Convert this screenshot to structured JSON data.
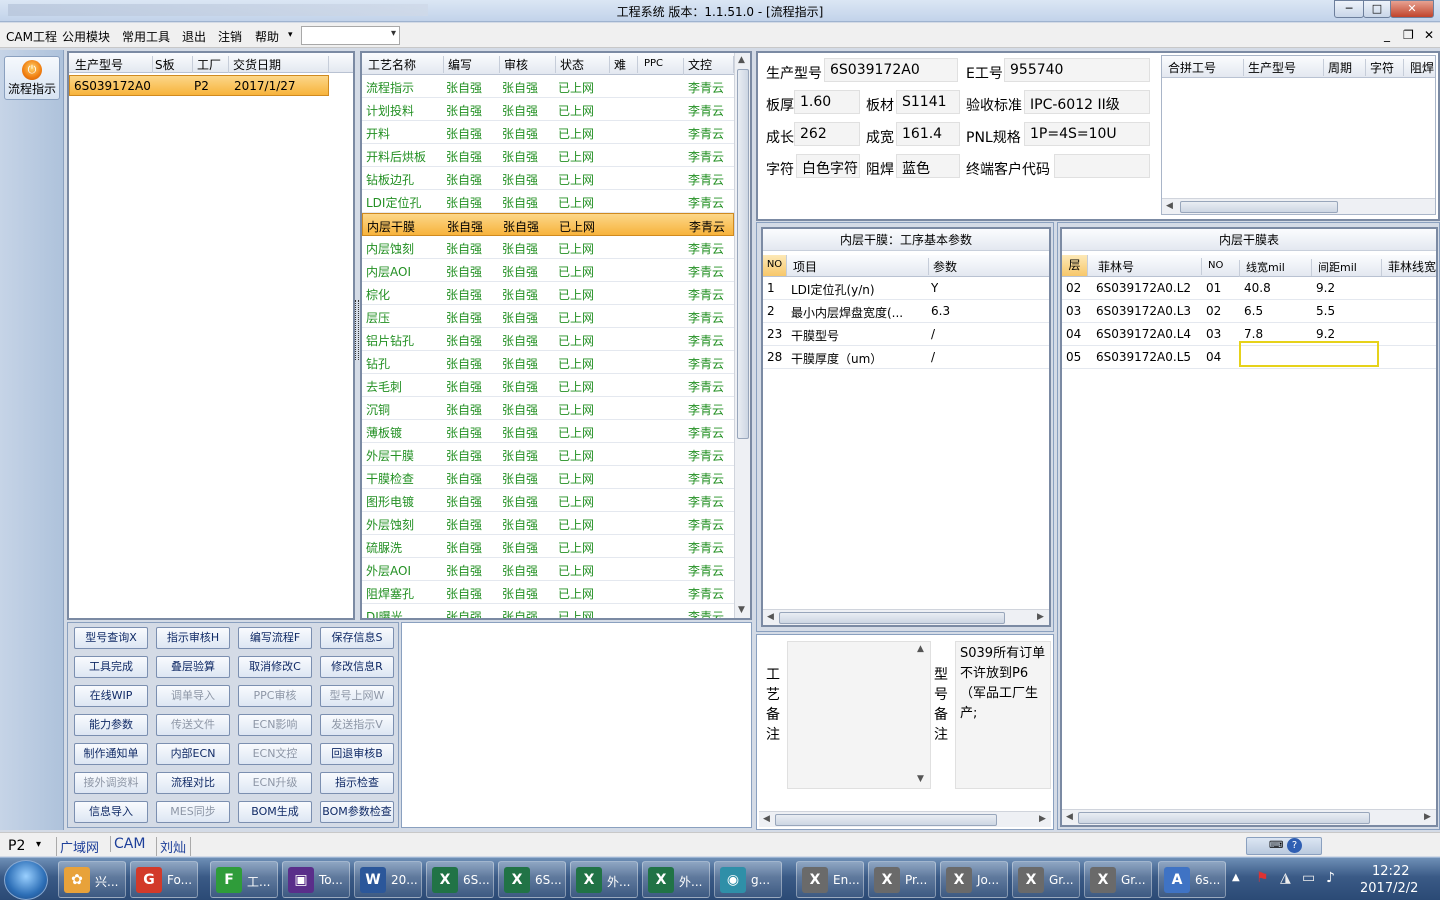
{
  "window": {
    "title": "工程系统   版本：1.1.51.0 - [流程指示]",
    "minimize": "─",
    "maximize": "□",
    "close": "✕"
  },
  "menu": {
    "items": [
      "CAM工程",
      "公用模块",
      "常用工具",
      "退出",
      "注销",
      "帮助"
    ],
    "help_arrow": "▾",
    "mdi_min": "_",
    "mdi_restore": "❐",
    "mdi_close": "✕"
  },
  "sidebar": {
    "flow_label": "流程指示"
  },
  "orders": {
    "headers": [
      "生产型号",
      "S板",
      "工厂",
      "交货日期"
    ],
    "rows": [
      [
        "6S039172A0",
        "",
        "P2",
        "2017/1/27"
      ]
    ]
  },
  "process": {
    "headers": [
      "工艺名称",
      "编写",
      "审核",
      "状态",
      "难",
      "PPC",
      "文控"
    ],
    "rows": [
      [
        "流程指示",
        "张自强",
        "张自强",
        "已上网",
        "",
        "",
        "李青云"
      ],
      [
        "计划投料",
        "张自强",
        "张自强",
        "已上网",
        "",
        "",
        "李青云"
      ],
      [
        "开料",
        "张自强",
        "张自强",
        "已上网",
        "",
        "",
        "李青云"
      ],
      [
        "开料后烘板",
        "张自强",
        "张自强",
        "已上网",
        "",
        "",
        "李青云"
      ],
      [
        "钻板边孔",
        "张自强",
        "张自强",
        "已上网",
        "",
        "",
        "李青云"
      ],
      [
        "LDI定位孔",
        "张自强",
        "张自强",
        "已上网",
        "",
        "",
        "李青云"
      ],
      [
        "内层干膜",
        "张自强",
        "张自强",
        "已上网",
        "",
        "",
        "李青云"
      ],
      [
        "内层蚀刻",
        "张自强",
        "张自强",
        "已上网",
        "",
        "",
        "李青云"
      ],
      [
        "内层AOI",
        "张自强",
        "张自强",
        "已上网",
        "",
        "",
        "李青云"
      ],
      [
        "棕化",
        "张自强",
        "张自强",
        "已上网",
        "",
        "",
        "李青云"
      ],
      [
        "层压",
        "张自强",
        "张自强",
        "已上网",
        "",
        "",
        "李青云"
      ],
      [
        "铝片钻孔",
        "张自强",
        "张自强",
        "已上网",
        "",
        "",
        "李青云"
      ],
      [
        "钻孔",
        "张自强",
        "张自强",
        "已上网",
        "",
        "",
        "李青云"
      ],
      [
        "去毛刺",
        "张自强",
        "张自强",
        "已上网",
        "",
        "",
        "李青云"
      ],
      [
        "沉铜",
        "张自强",
        "张自强",
        "已上网",
        "",
        "",
        "李青云"
      ],
      [
        "薄板镀",
        "张自强",
        "张自强",
        "已上网",
        "",
        "",
        "李青云"
      ],
      [
        "外层干膜",
        "张自强",
        "张自强",
        "已上网",
        "",
        "",
        "李青云"
      ],
      [
        "干膜检查",
        "张自强",
        "张自强",
        "已上网",
        "",
        "",
        "李青云"
      ],
      [
        "图形电镀",
        "张自强",
        "张自强",
        "已上网",
        "",
        "",
        "李青云"
      ],
      [
        "外层蚀刻",
        "张自强",
        "张自强",
        "已上网",
        "",
        "",
        "李青云"
      ],
      [
        "硫脲洗",
        "张自强",
        "张自强",
        "已上网",
        "",
        "",
        "李青云"
      ],
      [
        "外层AOI",
        "张自强",
        "张自强",
        "已上网",
        "",
        "",
        "李青云"
      ],
      [
        "阻焊塞孔",
        "张自强",
        "张自强",
        "已上网",
        "",
        "",
        "李青云"
      ],
      [
        "DI曝光",
        "张自强",
        "张自强",
        "已上网",
        "",
        "",
        "李青云"
      ]
    ],
    "selected_index": 6
  },
  "buttons": [
    {
      "label": "型号查询X",
      "enabled": true
    },
    {
      "label": "指示审核H",
      "enabled": true
    },
    {
      "label": "编写流程F",
      "enabled": true
    },
    {
      "label": "保存信息S",
      "enabled": true
    },
    {
      "label": "工具完成",
      "enabled": true
    },
    {
      "label": "叠层验算",
      "enabled": true
    },
    {
      "label": "取消修改C",
      "enabled": true
    },
    {
      "label": "修改信息R",
      "enabled": true
    },
    {
      "label": "在线WIP",
      "enabled": true
    },
    {
      "label": "调单导入",
      "enabled": false
    },
    {
      "label": "PPC审核",
      "enabled": false
    },
    {
      "label": "型号上网W",
      "enabled": false
    },
    {
      "label": "能力参数",
      "enabled": true
    },
    {
      "label": "传送文件",
      "enabled": false
    },
    {
      "label": "ECN影响",
      "enabled": false
    },
    {
      "label": "发送指示V",
      "enabled": false
    },
    {
      "label": "制作通知单",
      "enabled": true
    },
    {
      "label": "内部ECN",
      "enabled": true
    },
    {
      "label": "ECN文控",
      "enabled": false
    },
    {
      "label": "回退审核B",
      "enabled": true
    },
    {
      "label": "接外调资料",
      "enabled": false
    },
    {
      "label": "流程对比",
      "enabled": true
    },
    {
      "label": "ECN升级",
      "enabled": false
    },
    {
      "label": "指示检查",
      "enabled": true
    },
    {
      "label": "信息导入",
      "enabled": true
    },
    {
      "label": "MES同步",
      "enabled": false
    },
    {
      "label": "BOM生成",
      "enabled": true
    },
    {
      "label": "BOM参数检查",
      "enabled": true
    }
  ],
  "info": {
    "prod_model_label": "生产型号",
    "prod_model": "6S039172A0",
    "e_job_label": "E工号",
    "e_job": "955740",
    "thickness_label": "板厚",
    "thickness": "1.60",
    "material_label": "板材",
    "material": "S1141",
    "standard_label": "验收标准",
    "standard": "IPC-6012 II级",
    "length_label": "成长",
    "length": "262",
    "width_label": "成宽",
    "width": "161.4",
    "pnl_label": "PNL规格",
    "pnl": "1P=4S=10U",
    "char_label": "字符",
    "char": "白色字符",
    "mask_label": "阻焊",
    "mask": "蓝色",
    "customer_label": "终端客户代码",
    "customer": ""
  },
  "merge": {
    "headers": [
      "合拼工号",
      "生产型号",
      "周期",
      "字符",
      "阻焊"
    ]
  },
  "params": {
    "title": "内层干膜：工序基本参数",
    "headers": [
      "NO",
      "项目",
      "参数"
    ],
    "rows": [
      [
        "1",
        "LDI定位孔(y/n)",
        "Y"
      ],
      [
        "2",
        "最小内层焊盘宽度(...",
        "6.3"
      ],
      [
        "23",
        "干膜型号",
        "/"
      ],
      [
        "28",
        "干膜厚度（um）",
        "/"
      ]
    ]
  },
  "layers": {
    "title": "内层干膜表",
    "headers": [
      "层",
      "菲林号",
      "NO",
      "线宽mil",
      "间距mil",
      "菲林线宽"
    ],
    "rows": [
      [
        "02",
        "6S039172A0.L2",
        "01",
        "40.8",
        "9.2"
      ],
      [
        "03",
        "6S039172A0.L3",
        "02",
        "6.5",
        "5.5"
      ],
      [
        "04",
        "6S039172A0.L4",
        "03",
        "7.8",
        "9.2"
      ],
      [
        "05",
        "6S039172A0.L5",
        "04",
        "",
        ""
      ]
    ]
  },
  "remarks": {
    "process_label": [
      "工",
      "艺",
      "备",
      "注"
    ],
    "model_label": [
      "型",
      "号",
      "备",
      "注"
    ],
    "model_text": "S039所有订单不许放到P6（军品工厂生产;"
  },
  "status": {
    "factory": "P2",
    "arrow": "▾",
    "net": "广域网",
    "module": "CAM",
    "user": "刘灿"
  },
  "taskbar": {
    "items": [
      {
        "label": "兴...",
        "icon": "✿",
        "color": "#e8a23a"
      },
      {
        "label": "Fo...",
        "icon": "G",
        "color": "#d23a2a"
      },
      {
        "label": "工...",
        "icon": "F",
        "color": "#2f9c3a"
      },
      {
        "label": "To...",
        "icon": "▣",
        "color": "#5a2e8a"
      },
      {
        "label": "20...",
        "icon": "W",
        "color": "#2b579a"
      },
      {
        "label": "6S...",
        "icon": "X",
        "color": "#217346"
      },
      {
        "label": "6S...",
        "icon": "X",
        "color": "#217346"
      },
      {
        "label": "外...",
        "icon": "X",
        "color": "#217346"
      },
      {
        "label": "外...",
        "icon": "X",
        "color": "#217346"
      },
      {
        "label": "g...",
        "icon": "◉",
        "color": "#2f8fa8"
      },
      {
        "label": "En...",
        "icon": "X",
        "color": "#6a6a6a"
      },
      {
        "label": "Pr...",
        "icon": "X",
        "color": "#6a6a6a"
      },
      {
        "label": "Jo...",
        "icon": "X",
        "color": "#6a6a6a"
      },
      {
        "label": "Gr...",
        "icon": "X",
        "color": "#6a6a6a"
      },
      {
        "label": "Gr...",
        "icon": "X",
        "color": "#6a6a6a"
      },
      {
        "label": "6s...",
        "icon": "A",
        "color": "#3f73c4"
      }
    ],
    "time": "12:22",
    "date": "2017/2/2",
    "tray_arrow": "▲"
  }
}
